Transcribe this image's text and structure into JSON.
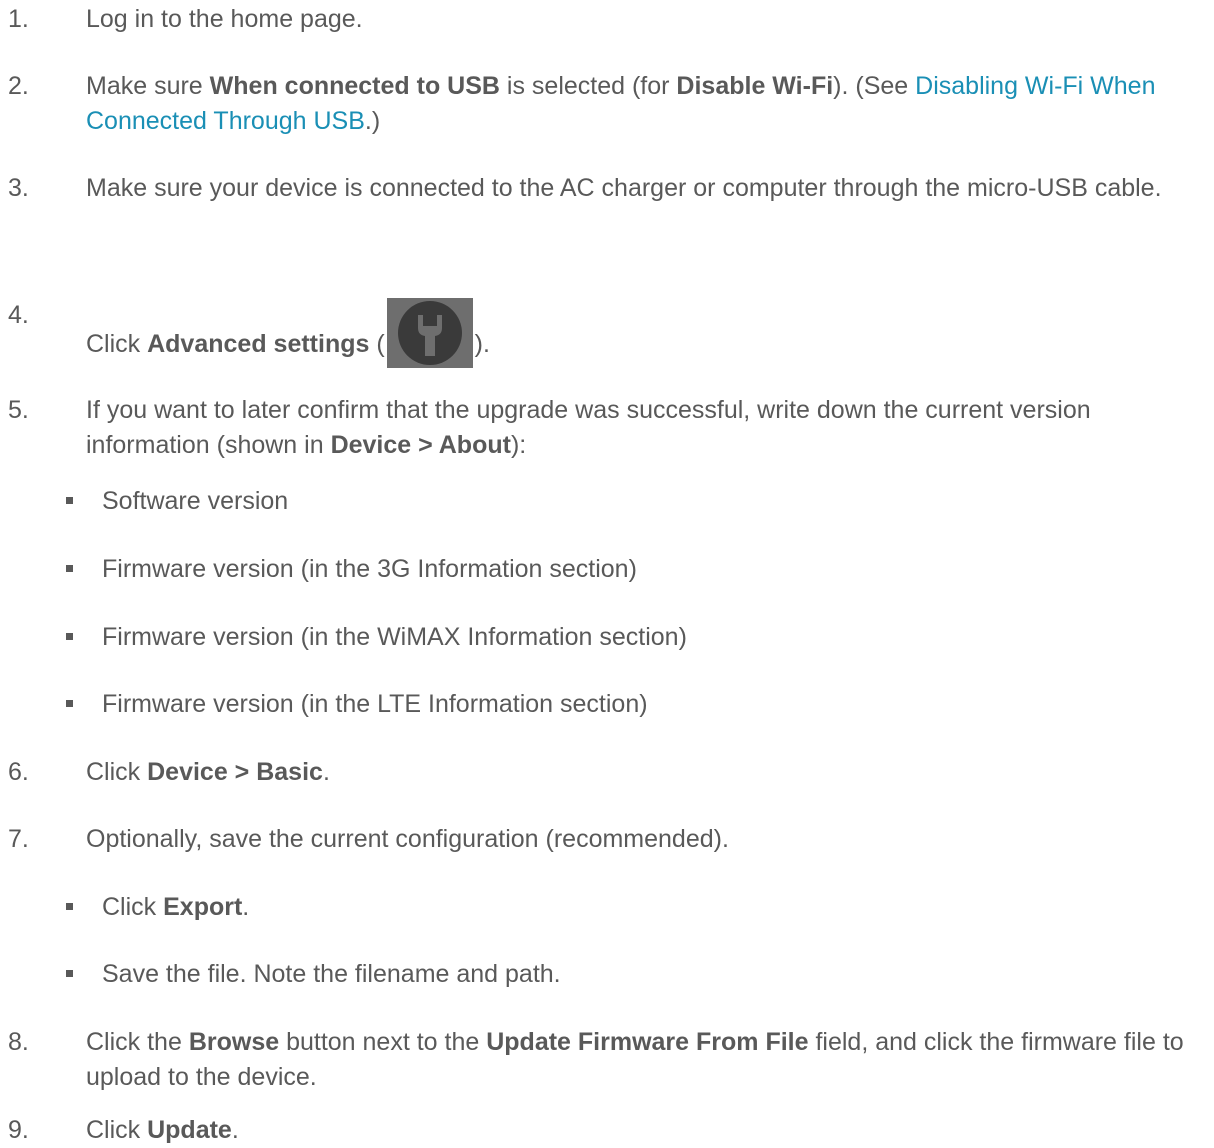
{
  "steps": [
    {
      "number": "1.",
      "text": "Log in to the home page."
    },
    {
      "number": "2.",
      "pre": "Make sure ",
      "bold1": "When connected to USB",
      "mid": " is selected (for ",
      "bold2": "Disable Wi-Fi",
      "post": "). (See ",
      "link": "Disabling Wi-Fi When Connected Through USB",
      "end": ".)"
    },
    {
      "number": "3.",
      "text": "Make sure your device is connected to the AC charger or computer through the micro-USB cable."
    },
    {
      "number": "4.",
      "pre": "Click ",
      "bold": "Advanced settings",
      "open": " (",
      "close": ").",
      "icon": "wrench-icon"
    },
    {
      "number": "5.",
      "pre": "If you want to later confirm that the upgrade was successful, write down the current version information (shown in ",
      "bold": "Device > About",
      "post": "):",
      "bullets": [
        "Software version",
        "Firmware version (in the 3G Information section)",
        "Firmware version (in the WiMAX Information section)",
        "Firmware version (in the LTE Information section)"
      ]
    },
    {
      "number": "6.",
      "pre": "Click ",
      "bold": "Device > Basic",
      "post": "."
    },
    {
      "number": "7.",
      "text": "Optionally, save the current configuration (recommended).",
      "bullet1_pre": "Click ",
      "bullet1_bold": "Export",
      "bullet1_post": ".",
      "bullet2": "Save the file. Note the filename and path."
    },
    {
      "number": "8.",
      "pre": "Click the ",
      "bold1": "Browse",
      "mid": " button next to the ",
      "bold2": "Update Firmware From File",
      "post": " field, and click the firmware file to upload to the device."
    },
    {
      "number": "9.",
      "pre": "Click ",
      "bold": "Update",
      "post": "."
    }
  ],
  "colors": {
    "text": "#595959",
    "link": "#1a8fb5",
    "icon_background": "#6e6e6e",
    "icon_glyph": "#3a3a3a"
  }
}
